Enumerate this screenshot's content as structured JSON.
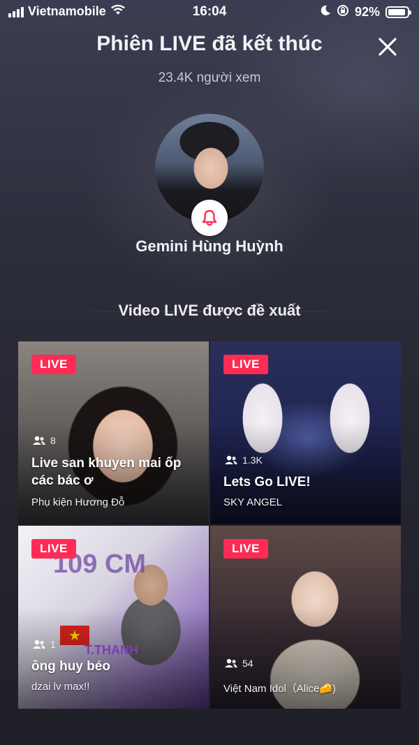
{
  "status_bar": {
    "carrier": "Vietnamobile",
    "time": "16:04",
    "battery": "92%",
    "battery_level": 0.92
  },
  "header": {
    "title": "Phiên LIVE đã kết thúc",
    "viewers": "23.4K người xem"
  },
  "host": {
    "name": "Gemini Hùng Huỳnh"
  },
  "section": {
    "title": "Video LIVE được đề xuất"
  },
  "colors": {
    "live_badge": "#fe2c55",
    "bell": "#fe2c55"
  },
  "cards": [
    {
      "badge": "LIVE",
      "viewers": "8",
      "title": "Live san khuyen mai ốp các bác ơ",
      "subtitle": "Phụ kiện Hương Đỗ"
    },
    {
      "badge": "LIVE",
      "viewers": "1.3K",
      "title": "Lets Go LIVE!",
      "subtitle": "SKY ANGEL"
    },
    {
      "badge": "LIVE",
      "viewers": "1",
      "title": "ông huy béo",
      "subtitle": "dzai lv max!!",
      "overlay_text": "109 CM",
      "overlay_name": "T.THANH"
    },
    {
      "badge": "LIVE",
      "viewers": "54",
      "title": "",
      "subtitle": "Việt Nam Idol（Alice🧀)"
    }
  ]
}
